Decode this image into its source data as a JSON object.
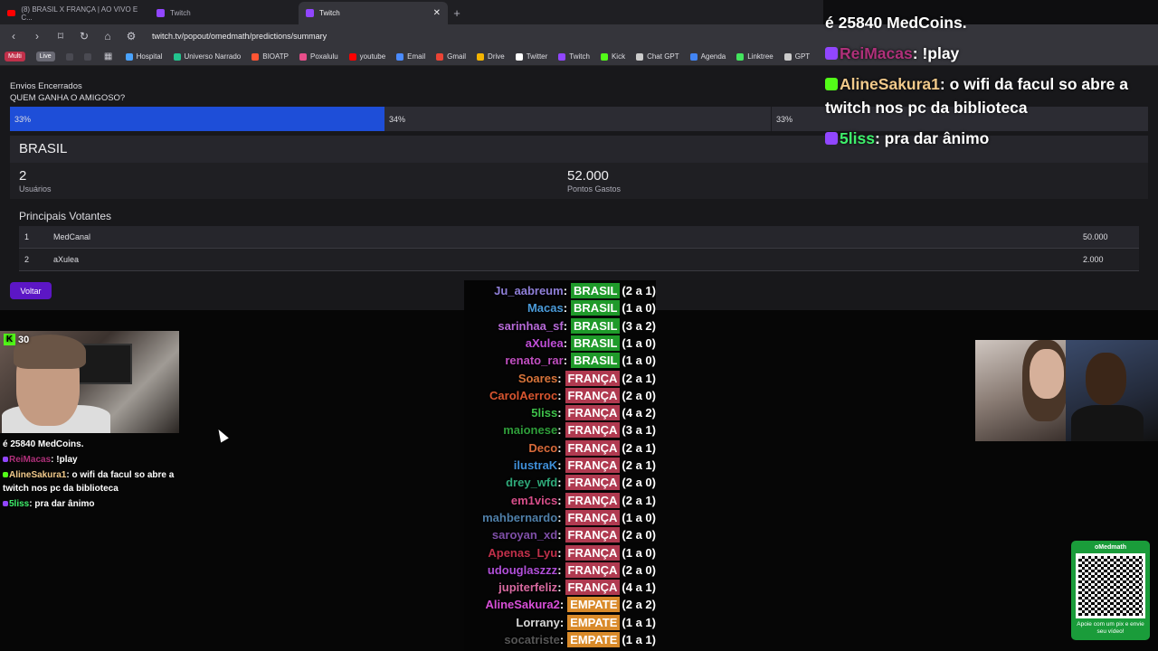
{
  "tabs": [
    {
      "label": "(8) BRASIL X FRANÇA | AO VIVO E C...",
      "icon": "youtube-icon"
    },
    {
      "label": "Twitch",
      "icon": "twitch-icon"
    },
    {
      "label": "Twitch",
      "icon": "twitch-icon",
      "active": true
    }
  ],
  "address": {
    "url": "twitch.tv/popout/omedmath/predictions/summary"
  },
  "bookmarks": [
    {
      "label": "Hospital",
      "color": "#4aa3ff"
    },
    {
      "label": "Universo Narrado",
      "color": "#23c48e"
    },
    {
      "label": "BIOATP",
      "color": "#ff5533"
    },
    {
      "label": "Poxalulu",
      "color": "#e84e8a"
    },
    {
      "label": "youtube",
      "color": "#ff0000"
    },
    {
      "label": "Email",
      "color": "#4a8bff"
    },
    {
      "label": "Gmail",
      "color": "#ea4335"
    },
    {
      "label": "Drive",
      "color": "#f4b400"
    },
    {
      "label": "Twitter",
      "color": "#ffffff"
    },
    {
      "label": "Twitch",
      "color": "#9146ff"
    },
    {
      "label": "Kick",
      "color": "#53fc18"
    },
    {
      "label": "Chat GPT",
      "color": "#cccccc"
    },
    {
      "label": "Agenda",
      "color": "#4285f4"
    },
    {
      "label": "Linktree",
      "color": "#43e55e"
    },
    {
      "label": "GPT",
      "color": "#cccccc"
    }
  ],
  "bookmark_chips": {
    "multi": "Multi",
    "live": "Live"
  },
  "prediction": {
    "status": "Envios Encerrados",
    "question": "QUEM GANHA O AMIGOSO?",
    "bar": [
      {
        "pct": "33%",
        "color": "#1e4ed8"
      },
      {
        "pct": "34%",
        "color": "#2c2c33"
      },
      {
        "pct": "33%",
        "color": "#2c2c33"
      }
    ],
    "outcome": "BRASIL",
    "users_value": "2",
    "users_label": "Usuários",
    "points_value": "52.000",
    "points_label": "Pontos Gastos",
    "top_title": "Principais Votantes",
    "top_voters": [
      {
        "rank": "1",
        "name": "MedCanal",
        "points": "50.000"
      },
      {
        "rank": "2",
        "name": "aXulea",
        "points": "2.000"
      }
    ],
    "back_label": "Voltar"
  },
  "cam_left": {
    "kick_count": "30"
  },
  "chat_small": [
    {
      "user": "",
      "text": "é 25840 MedCoins.",
      "color": "#ffffff"
    },
    {
      "user": "ReiMacas",
      "text": ": !play",
      "color": "#b0307a"
    },
    {
      "user": "AlineSakura1",
      "text": ": o wifi da facul so abre a twitch nos pc da biblioteca",
      "color": "#f1c98a"
    },
    {
      "user": "5liss",
      "text": ": pra dar ânimo",
      "color": "#3ef06b"
    }
  ],
  "chat_big": [
    {
      "user": "",
      "text": "é 25840 MedCoins.",
      "color": "#ffffff"
    },
    {
      "user": "ReiMacas",
      "text": ": !play",
      "color": "#b0307a"
    },
    {
      "user": "AlineSakura1",
      "text": ": o wifi da facul so abre a twitch nos pc da biblioteca",
      "color": "#f1c98a"
    },
    {
      "user": "5liss",
      "text": ": pra dar ânimo",
      "color": "#3ef06b"
    }
  ],
  "votes": [
    {
      "user": "Ju_aabreum",
      "team": "BRASIL",
      "score": "(2 a 1)",
      "color": "#8f7fd8"
    },
    {
      "user": "Macas",
      "team": "BRASIL",
      "score": "(1 a 0)",
      "color": "#4a9ad8"
    },
    {
      "user": "sarinhaa_sf",
      "team": "BRASIL",
      "score": "(3 a 2)",
      "color": "#b76ad8"
    },
    {
      "user": "aXulea",
      "team": "BRASIL",
      "score": "(1 a 0)",
      "color": "#c04fd8"
    },
    {
      "user": "renato_rar",
      "team": "BRASIL",
      "score": "(1 a 0)",
      "color": "#c04fc0"
    },
    {
      "user": "Soares",
      "team": "FRANÇA",
      "score": "(2 a 1)",
      "color": "#d8743a"
    },
    {
      "user": "CarolAerroc",
      "team": "FRANÇA",
      "score": "(2 a 0)",
      "color": "#d8552f"
    },
    {
      "user": "5liss",
      "team": "FRANÇA",
      "score": "(4 a 2)",
      "color": "#3ec04a"
    },
    {
      "user": "maionese",
      "team": "FRANÇA",
      "score": "(3 a 1)",
      "color": "#2f9d3a"
    },
    {
      "user": "Deco",
      "team": "FRANÇA",
      "score": "(2 a 1)",
      "color": "#d86a3a"
    },
    {
      "user": "ilustraK",
      "team": "FRANÇA",
      "score": "(2 a 1)",
      "color": "#3f8fd8"
    },
    {
      "user": "drey_wfd",
      "team": "FRANÇA",
      "score": "(2 a 0)",
      "color": "#2faa7a"
    },
    {
      "user": "em1vics",
      "team": "FRANÇA",
      "score": "(2 a 1)",
      "color": "#d84f8a"
    },
    {
      "user": "mahbernardo",
      "team": "FRANÇA",
      "score": "(1 a 0)",
      "color": "#4f7fa8"
    },
    {
      "user": "saroyan_xd",
      "team": "FRANÇA",
      "score": "(2 a 0)",
      "color": "#7f4fa8"
    },
    {
      "user": "Apenas_Lyu",
      "team": "FRANÇA",
      "score": "(1 a 0)",
      "color": "#c0304a"
    },
    {
      "user": "udouglaszzz",
      "team": "FRANÇA",
      "score": "(2 a 0)",
      "color": "#b04fd8"
    },
    {
      "user": "jupiterfeliz",
      "team": "FRANÇA",
      "score": "(4 a 1)",
      "color": "#d86aa0"
    },
    {
      "user": "AlineSakura2",
      "team": "EMPATE",
      "score": "(2 a 2)",
      "color": "#d84fd8"
    },
    {
      "user": "Lorrany",
      "team": "EMPATE",
      "score": "(1 a 1)",
      "color": "#d8d8d8"
    },
    {
      "user": "socatriste",
      "team": "EMPATE",
      "score": "(1 a 1)",
      "color": "#555555"
    }
  ],
  "team_colors": {
    "BRASIL": "#1f9a2a",
    "FRANÇA": "#b03a50",
    "EMPATE": "#d98a2a"
  },
  "qr": {
    "title": "oMedmath",
    "caption": "Apoie com um pix e envie seu vídeo!"
  }
}
